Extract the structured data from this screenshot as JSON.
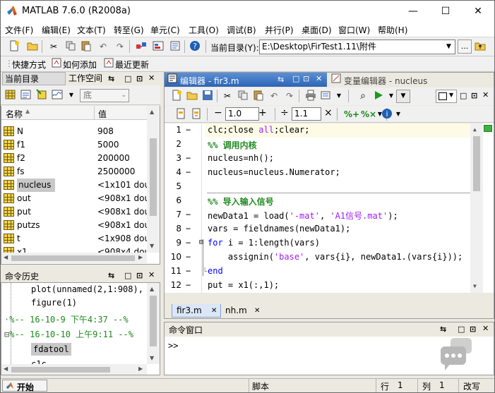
{
  "window": {
    "title": "MATLAB  7.6.0 (R2008a)",
    "minimize": "—",
    "maximize": "☐",
    "close": "✕"
  },
  "menu": [
    "文件(F)",
    "编辑(E)",
    "文本(T)",
    "转至(G)",
    "单元(C)",
    "工具(O)",
    "调试(B)",
    "并行(P)",
    "桌面(D)",
    "窗口(W)",
    "帮助(H)"
  ],
  "toolbar": {
    "dir_label": "当前目录(Y):",
    "dir_value": "E:\\Desktop\\FirTest1.11\\附件",
    "browse": "..."
  },
  "shortcuts": {
    "shortcut": "快捷方式",
    "howto_add": "如何添加",
    "whats_new": "最近更新"
  },
  "left_tabs": {
    "current_dir": "当前目录",
    "workspace": "工作空间"
  },
  "workspace": {
    "stack_label": "底",
    "col_name": "名称",
    "col_value": "值",
    "rows": [
      {
        "name": "N",
        "value": "908"
      },
      {
        "name": "f1",
        "value": "5000"
      },
      {
        "name": "f2",
        "value": "200000"
      },
      {
        "name": "fs",
        "value": "2500000"
      },
      {
        "name": "nucleus",
        "value": "<1x101 dou"
      },
      {
        "name": "out",
        "value": "<908x1 dou"
      },
      {
        "name": "put",
        "value": "<908x1 dou"
      },
      {
        "name": "putzs",
        "value": "<908x1 dou"
      },
      {
        "name": "t",
        "value": "<1x908 dou"
      },
      {
        "name": "x1",
        "value": "<908x4 dou"
      }
    ]
  },
  "history": {
    "title": "命令历史",
    "lines": [
      "plot(unnamed(2,1:908),",
      "figure(1)",
      "%-- 16-10-9 下午4:37 --%",
      "%-- 16-10-10 上午9:11 --%",
      "fdatool",
      "c1c"
    ]
  },
  "editor": {
    "title": "编辑器 - fir3.m",
    "var_editor": "变量编辑器 - nucleus",
    "zoom1": "1.0",
    "zoom2": "1.1",
    "minus": "−",
    "plus": "+",
    "divide": "÷",
    "times": "×",
    "lines": [
      {
        "n": "1",
        "dash": "−",
        "html": "clc;close <span class='str'>all</span>;clear;"
      },
      {
        "n": "2",
        "dash": "",
        "html": "<span class='cmt'>%% 调用内核</span>"
      },
      {
        "n": "3",
        "dash": "−",
        "html": "nucleus=nh();"
      },
      {
        "n": "4",
        "dash": "−",
        "html": "nucleus=nucleus.Numerator;"
      },
      {
        "n": "5",
        "dash": "",
        "html": ""
      },
      {
        "n": "6",
        "dash": "",
        "html": "<span class='cmt'>%% 导入输入信号</span>"
      },
      {
        "n": "7",
        "dash": "−",
        "html": "newData1 = load(<span class='str'>'-mat'</span>, <span class='str'>'A1信号.mat'</span>);"
      },
      {
        "n": "8",
        "dash": "−",
        "html": "vars = fieldnames(newData1);"
      },
      {
        "n": "9",
        "dash": "−",
        "html": "<span class='kw'>for</span> i = 1:length(vars)"
      },
      {
        "n": "10",
        "dash": "−",
        "html": "    assignin(<span class='str'>'base'</span>, vars{i}, newData1.(vars{i}));"
      },
      {
        "n": "11",
        "dash": "−",
        "html": "<span class='kw'>end</span>"
      },
      {
        "n": "12",
        "dash": "−",
        "html": "put = x1(:,1);"
      }
    ],
    "tabs": [
      "fir3.m",
      "nh.m"
    ]
  },
  "command": {
    "title": "命令窗口",
    "prompt": ">>"
  },
  "status": {
    "start": "开始(S)",
    "mode": "脚本",
    "row_label": "行",
    "row": "1",
    "col_label": "列",
    "col": "1",
    "ovr": "改写"
  }
}
